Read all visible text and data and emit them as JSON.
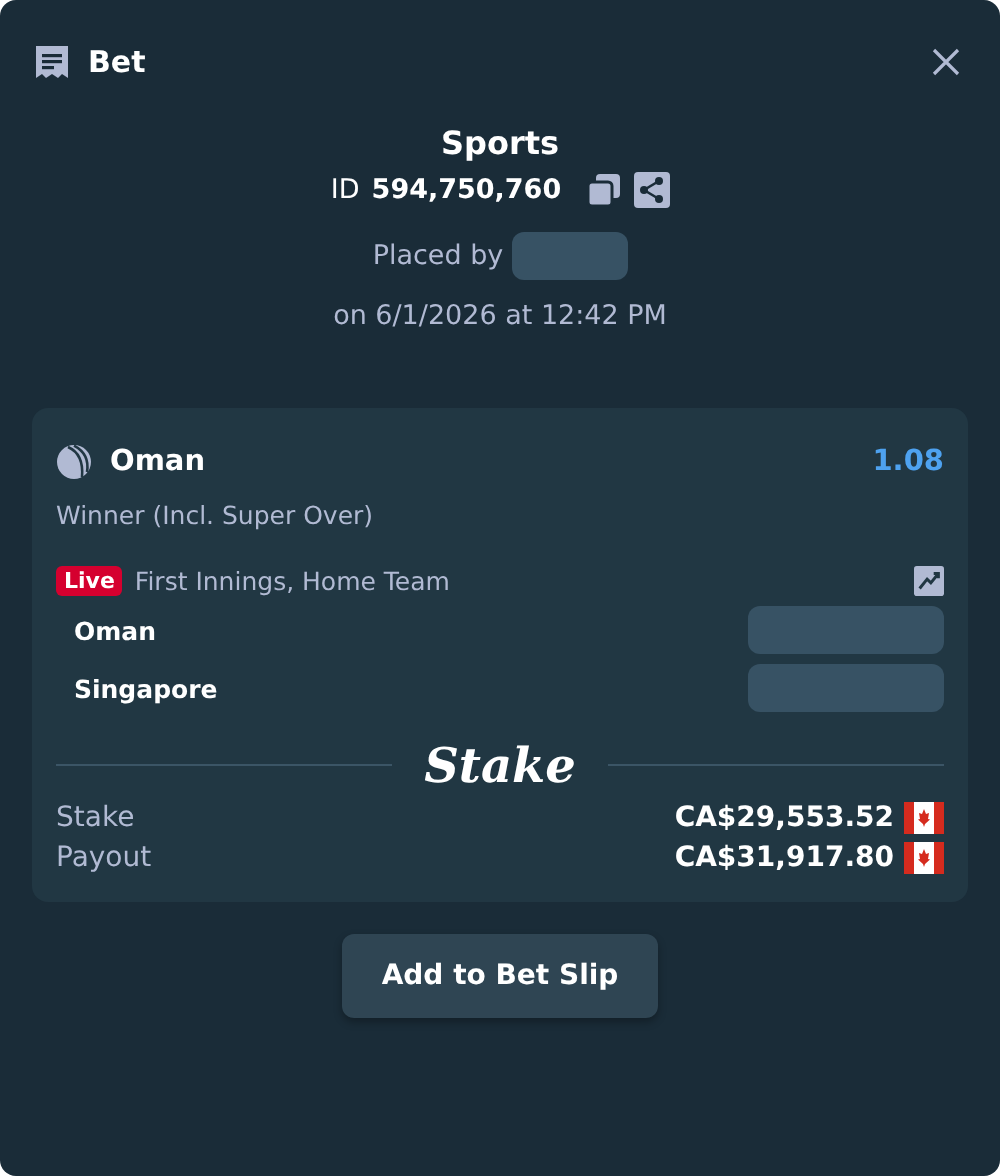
{
  "header": {
    "title": "Bet"
  },
  "summary": {
    "category": "Sports",
    "id_label": "ID",
    "id_value": "594,750,760",
    "placed_by": "Placed by",
    "placed_on": "on 6/1/2026 at 12:42 PM"
  },
  "selection": {
    "name": "Oman",
    "odds": "1.08",
    "market": "Winner (Incl. Super Over)",
    "badge": "Live",
    "event": "First Innings, Home Team",
    "teams": [
      {
        "name": "Oman"
      },
      {
        "name": "Singapore"
      }
    ]
  },
  "logo": "Stake",
  "amounts": [
    {
      "label": "Stake",
      "value": "CA$29,553.52"
    },
    {
      "label": "Payout",
      "value": "CA$31,917.80"
    }
  ],
  "button": "Add to Bet Slip"
}
